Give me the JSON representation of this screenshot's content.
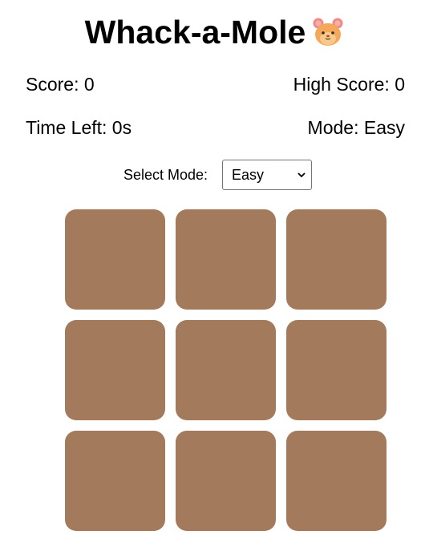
{
  "title": {
    "text": "Whack-a-Mole",
    "icon": "hamster-icon"
  },
  "stats": {
    "score": "Score: 0",
    "high_score": "High Score: 0",
    "time_left": "Time Left: 0s",
    "mode": "Mode: Easy"
  },
  "mode_select": {
    "label": "Select Mode:",
    "selected": "Easy"
  },
  "grid": {
    "rows": 3,
    "cols": 3,
    "hole_color": "#a47a5c"
  }
}
